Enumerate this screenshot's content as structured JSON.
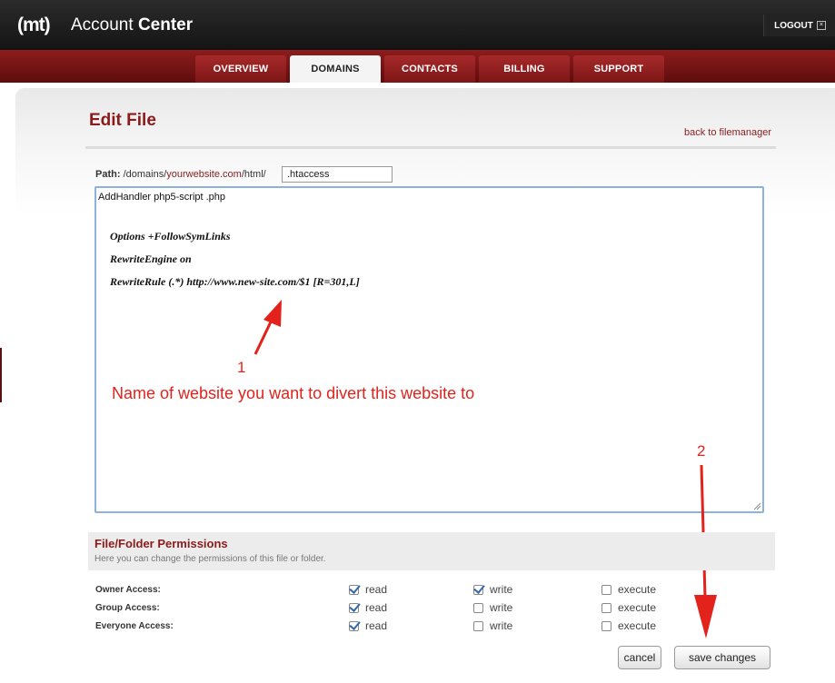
{
  "header": {
    "logo": "(mt)",
    "title_plain": "Account",
    "title_bold": "Center",
    "logout_label": "LOGOUT"
  },
  "tabs": [
    {
      "label": "OVERVIEW",
      "active": false
    },
    {
      "label": "DOMAINS",
      "active": true
    },
    {
      "label": "CONTACTS",
      "active": false
    },
    {
      "label": "BILLING",
      "active": false
    },
    {
      "label": "SUPPORT",
      "active": false
    }
  ],
  "page": {
    "title": "Edit File",
    "back_link": "back to filemanager"
  },
  "path": {
    "label": "Path:",
    "prefix": "/domains/",
    "site": "yourwebsite.com",
    "suffix": "/html/",
    "filename": ".htaccess"
  },
  "editor": {
    "line1": "AddHandler php5-script .php",
    "code_lines": [
      "Options +FollowSymLinks",
      "RewriteEngine on",
      "RewriteRule (.*) http://www.new-site.com/$1 [R=301,L]"
    ]
  },
  "annotations": {
    "marker1": "1",
    "note": "Name of website you want to divert this website to",
    "marker2": "2",
    "color": "#e3231b"
  },
  "permissions": {
    "title": "File/Folder Permissions",
    "description": "Here you can change the permissions of this file or folder.",
    "columns": [
      "read",
      "write",
      "execute"
    ],
    "rows": [
      {
        "label": "Owner Access:",
        "read": true,
        "write": true,
        "execute": false
      },
      {
        "label": "Group Access:",
        "read": true,
        "write": false,
        "execute": false
      },
      {
        "label": "Everyone Access:",
        "read": true,
        "write": false,
        "execute": false
      }
    ]
  },
  "buttons": {
    "cancel": "cancel",
    "save": "save changes"
  },
  "colors": {
    "brand": "#8b1b1b",
    "header": "#1e1e1e",
    "checkbox": "#3468a8"
  }
}
